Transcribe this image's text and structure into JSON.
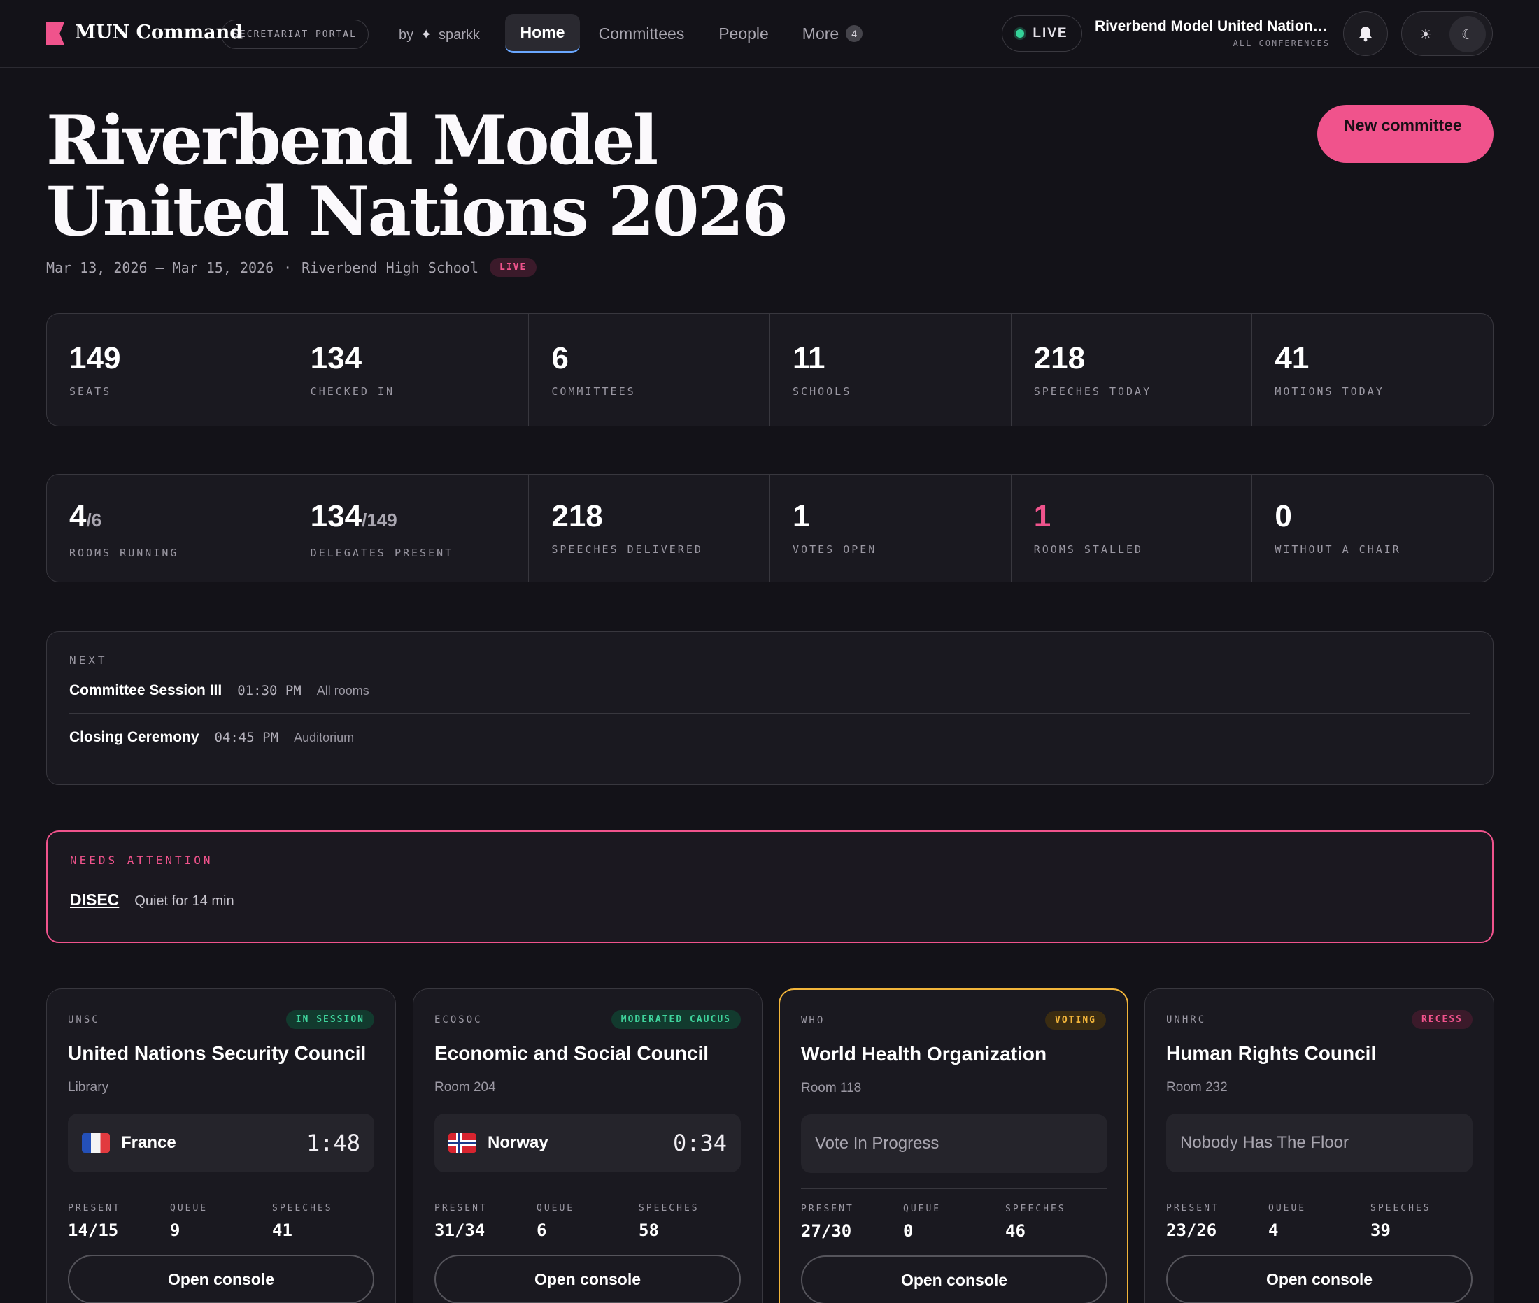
{
  "header": {
    "brand": "MUN Command",
    "portal": "SECRETARIAT PORTAL",
    "by_prefix": "by",
    "by_icon": "sparkle-icon",
    "by_name": "sparkk",
    "tabs": [
      {
        "label": "Home",
        "active": true
      },
      {
        "label": "Committees"
      },
      {
        "label": "People"
      },
      {
        "label": "More",
        "badge": "4"
      }
    ],
    "live": "LIVE",
    "conference_name": "Riverbend Model United Nations…",
    "conference_sub": "ALL CONFERENCES",
    "icons": {
      "bell": "bell-icon",
      "sun": "sun-icon",
      "moon": "moon-icon"
    }
  },
  "hero": {
    "title_line1": "Riverbend Model",
    "title_line2": "United Nations 2026",
    "dates": "Mar 13, 2026 – Mar 15, 2026",
    "separator": "·",
    "venue": "Riverbend High School",
    "status_tag": "LIVE",
    "new_button": "New committee"
  },
  "stats_today": [
    {
      "value": "149",
      "label": "SEATS"
    },
    {
      "value": "134",
      "label": "CHECKED IN"
    },
    {
      "value": "6",
      "label": "COMMITTEES"
    },
    {
      "value": "11",
      "label": "SCHOOLS"
    },
    {
      "value": "218",
      "label": "SPEECHES TODAY"
    },
    {
      "value": "41",
      "label": "MOTIONS TODAY"
    }
  ],
  "stats_live": [
    {
      "value": "4",
      "total": "/6",
      "label": "ROOMS RUNNING"
    },
    {
      "value": "134",
      "total": "/149",
      "label": "DELEGATES PRESENT"
    },
    {
      "value": "218",
      "total": "",
      "label": "SPEECHES DELIVERED"
    },
    {
      "value": "1",
      "total": "",
      "label": "VOTES OPEN"
    },
    {
      "value": "1",
      "total": "",
      "label": "ROOMS STALLED"
    },
    {
      "value": "0",
      "total": "",
      "label": "WITHOUT A CHAIR"
    }
  ],
  "next": {
    "label": "NEXT",
    "items": [
      {
        "name": "Committee Session III",
        "time": "01:30 PM",
        "where": "All rooms"
      },
      {
        "name": "Closing Ceremony",
        "time": "04:45 PM",
        "where": "Auditorium"
      }
    ]
  },
  "attention": {
    "label": "NEEDS ATTENTION",
    "committee": "DISEC",
    "detail": "Quiet for 14 min"
  },
  "committee_stat_labels": {
    "present": "PRESENT",
    "queue": "QUEUE",
    "speeches": "SPEECHES"
  },
  "committees": [
    {
      "abbr": "UNSC",
      "status": "IN SESSION",
      "name": "United Nations Security Council",
      "room": "Library",
      "floor_country": "France",
      "floor_timer": "1:48",
      "present": "14/15",
      "queue": "9",
      "speeches": "41",
      "button": "Open console"
    },
    {
      "abbr": "ECOSOC",
      "status": "MODERATED CAUCUS",
      "name": "Economic and Social Council",
      "room": "Room 204",
      "floor_country": "Norway",
      "floor_timer": "0:34",
      "present": "31/34",
      "queue": "6",
      "speeches": "58",
      "button": "Open console"
    },
    {
      "abbr": "WHO",
      "status": "VOTING",
      "name": "World Health Organization",
      "room": "Room 118",
      "floor_empty": "Vote In Progress",
      "present": "27/30",
      "queue": "0",
      "speeches": "46",
      "button": "Open console"
    },
    {
      "abbr": "UNHRC",
      "status": "RECESS",
      "name": "Human Rights Council",
      "room": "Room 232",
      "floor_empty": "Nobody Has The Floor",
      "present": "23/26",
      "queue": "4",
      "speeches": "39",
      "button": "Open console"
    }
  ],
  "colors": {
    "accent": "#f0538c",
    "live_green": "#34d399",
    "voting": "#f2b53a",
    "background": "#131218"
  }
}
